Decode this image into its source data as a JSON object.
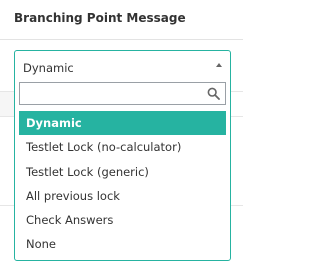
{
  "header": {
    "title": "Branching Point Message"
  },
  "select": {
    "value": "Dynamic",
    "search_value": "",
    "options": [
      {
        "label": "Dynamic",
        "selected": true
      },
      {
        "label": "Testlet Lock (no-calculator)",
        "selected": false
      },
      {
        "label": "Testlet Lock (generic)",
        "selected": false
      },
      {
        "label": "All previous lock",
        "selected": false
      },
      {
        "label": "Check Answers",
        "selected": false
      },
      {
        "label": "None",
        "selected": false
      }
    ]
  },
  "colors": {
    "accent": "#26b3a1",
    "text": "#333333"
  },
  "icons": {
    "caret": "caret-up-icon",
    "search": "search-icon"
  }
}
